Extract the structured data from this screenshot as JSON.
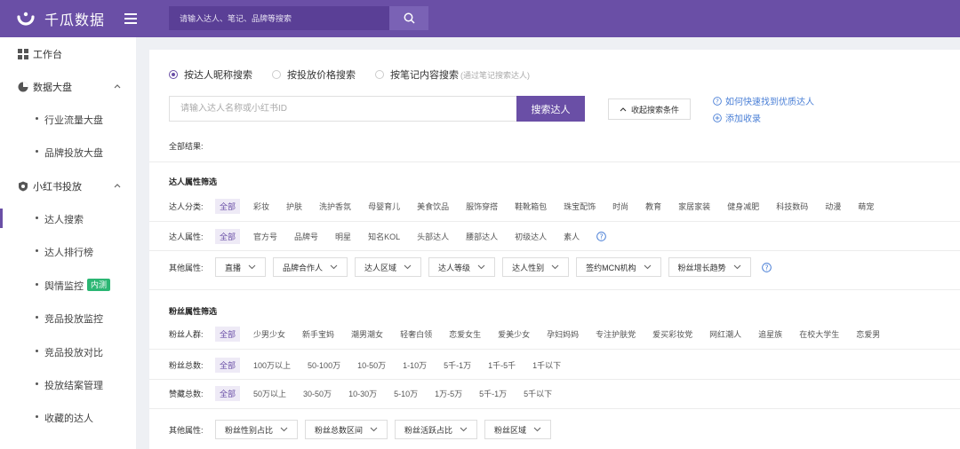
{
  "app": {
    "name": "千瓜数据"
  },
  "topbar": {
    "search_placeholder": "请输入达人、笔记、品牌等搜索"
  },
  "sidebar": {
    "items": [
      {
        "label": "工作台",
        "icon": "grid-icon"
      },
      {
        "label": "数据大盘",
        "icon": "pie-icon",
        "children": [
          "行业流量大盘",
          "品牌投放大盘"
        ]
      },
      {
        "label": "小红书投放",
        "icon": "xhs-icon",
        "children": [
          "达人搜索",
          "达人排行榜",
          "舆情监控",
          "竞品投放监控",
          "竞品投放对比",
          "投放结案管理",
          "收藏的达人"
        ]
      }
    ],
    "badge": "内测",
    "active": "达人搜索"
  },
  "search_modes": {
    "options": [
      "按达人昵称搜索",
      "按投放价格搜索",
      "按笔记内容搜索"
    ],
    "hint": "(通过笔记搜索达人)",
    "selected": "按达人昵称搜索"
  },
  "main_search": {
    "placeholder": "请输入达人名称或小红书ID",
    "button": "搜索达人",
    "collapse": "收起搜索条件",
    "link1": "如何快速找到优质达人",
    "link2": "添加收录"
  },
  "all_results": "全部结果:",
  "influencer_filter": {
    "title": "达人属性筛选",
    "category": {
      "label": "达人分类:",
      "tags": [
        "全部",
        "彩妆",
        "护肤",
        "洗护香氛",
        "母婴育儿",
        "美食饮品",
        "服饰穿搭",
        "鞋靴箱包",
        "珠宝配饰",
        "时尚",
        "教育",
        "家居家装",
        "健身减肥",
        "科技数码",
        "动漫",
        "萌宠"
      ]
    },
    "attribute": {
      "label": "达人属性:",
      "tags": [
        "全部",
        "官方号",
        "品牌号",
        "明星",
        "知名KOL",
        "头部达人",
        "腰部达人",
        "初级达人",
        "素人"
      ]
    },
    "other": {
      "label": "其他属性:",
      "dropdowns": [
        "直播",
        "品牌合作人",
        "达人区域",
        "达人等级",
        "达人性别",
        "签约MCN机构",
        "粉丝增长趋势"
      ]
    }
  },
  "fans_filter": {
    "title": "粉丝属性筛选",
    "crowd": {
      "label": "粉丝人群:",
      "tags": [
        "全部",
        "少男少女",
        "新手宝妈",
        "潮男潮女",
        "轻奢白领",
        "恋爱女生",
        "爱美少女",
        "孕妇妈妈",
        "专注护肤党",
        "爱买彩妆党",
        "网红潮人",
        "追星族",
        "在校大学生",
        "恋爱男"
      ]
    },
    "total": {
      "label": "粉丝总数:",
      "tags": [
        "全部",
        "100万以上",
        "50-100万",
        "10-50万",
        "1-10万",
        "5千-1万",
        "1千-5千",
        "1千以下"
      ]
    },
    "likes": {
      "label": "赞藏总数:",
      "tags": [
        "全部",
        "50万以上",
        "30-50万",
        "10-30万",
        "5-10万",
        "1万-5万",
        "5千-1万",
        "5千以下"
      ]
    },
    "other": {
      "label": "其他属性:",
      "dropdowns": [
        "粉丝性别占比",
        "粉丝总数区间",
        "粉丝活跃占比",
        "粉丝区域"
      ]
    }
  },
  "colors": {
    "brand": "#6a4fa6",
    "link": "#4a7fd6",
    "badge": "#2bb673"
  }
}
